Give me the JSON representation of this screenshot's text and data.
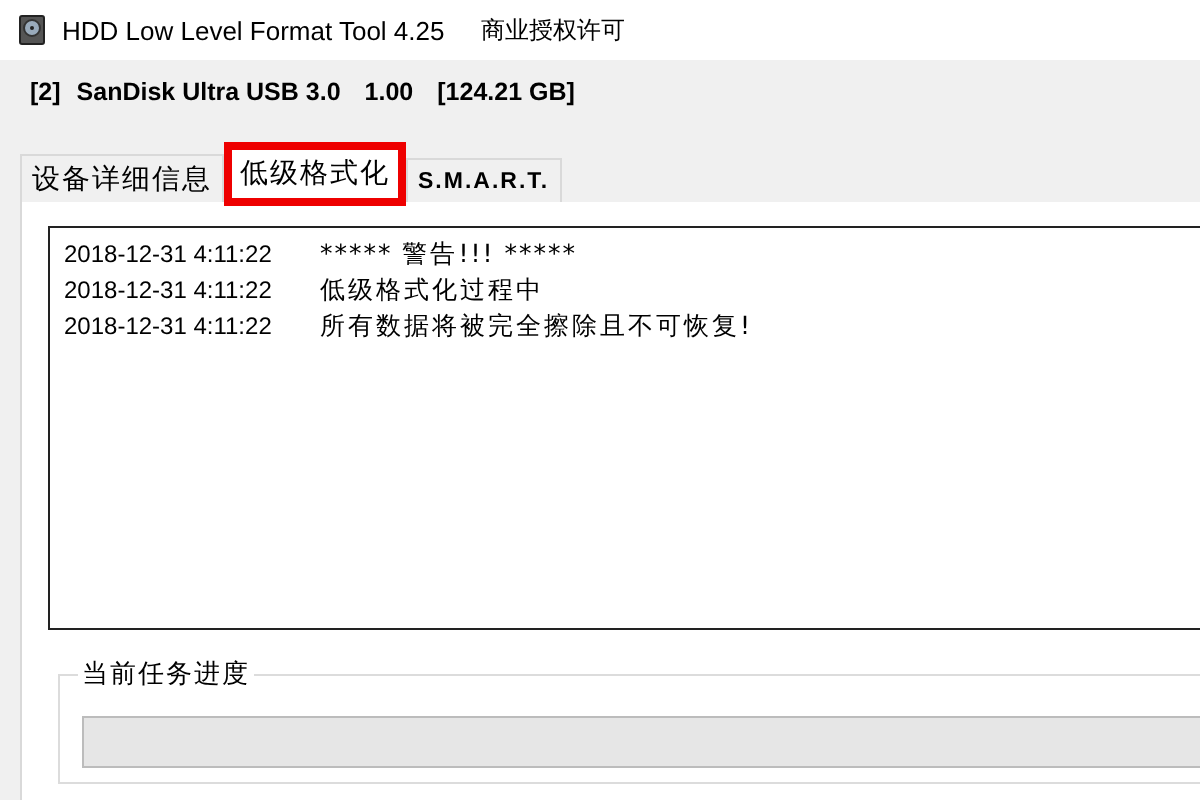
{
  "window": {
    "title": "HDD Low Level Format Tool 4.25",
    "license": "商业授权许可"
  },
  "device": {
    "index": "[2]",
    "name": "SanDisk Ultra USB 3.0",
    "version": "1.00",
    "capacity": "[124.21 GB]"
  },
  "tabs": [
    {
      "label": "设备详细信息",
      "selected": false
    },
    {
      "label": "低级格式化",
      "selected": true
    },
    {
      "label": "S.M.A.R.T.",
      "selected": false
    }
  ],
  "log": [
    {
      "time": "2018-12-31 4:11:22",
      "message": "***** 警告!!! *****"
    },
    {
      "time": "2018-12-31 4:11:22",
      "message": "低级格式化过程中"
    },
    {
      "time": "2018-12-31 4:11:22",
      "message": "所有数据将被完全擦除且不可恢复!"
    }
  ],
  "progress": {
    "title": "当前任务进度",
    "level": 0
  }
}
